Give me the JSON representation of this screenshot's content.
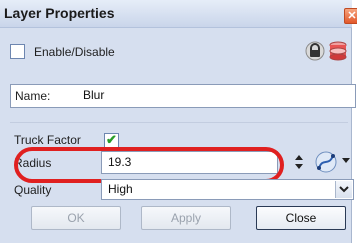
{
  "window": {
    "title": "Layer Properties",
    "close_glyph": "✕"
  },
  "enable": {
    "label": "Enable/Disable",
    "checked": false
  },
  "name": {
    "label": "Name:",
    "value": "Blur"
  },
  "truck_factor": {
    "label": "Truck Factor",
    "checked": true,
    "glyph": "✔"
  },
  "radius": {
    "label": "Radius",
    "value": "19.3"
  },
  "quality": {
    "label": "Quality",
    "value": "High"
  },
  "buttons": {
    "ok": "OK",
    "apply": "Apply",
    "close": "Close"
  },
  "icons": {
    "lock": "lock-icon",
    "color": "database-color-icon",
    "spinner": "spinner-arrows-icon",
    "function": "function-curve-icon",
    "dropdown": "chevron-down-icon"
  },
  "colors": {
    "highlight": "#e02020",
    "check": "#2a9d2a"
  }
}
